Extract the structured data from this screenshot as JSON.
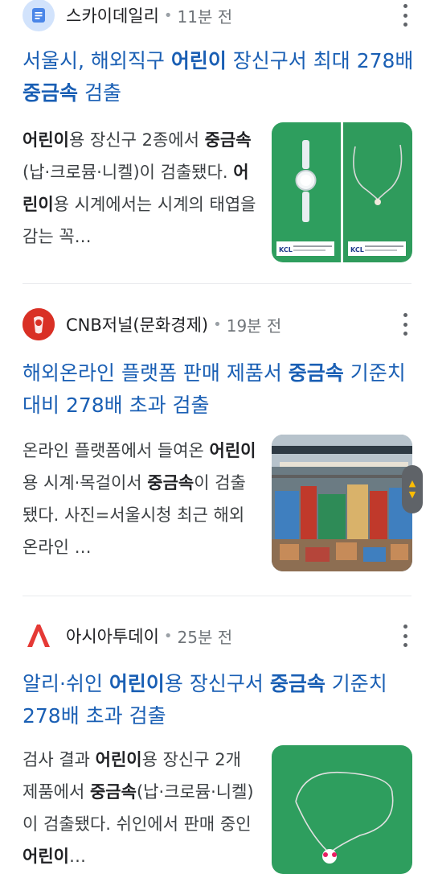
{
  "articles": [
    {
      "source": "스카이데일리",
      "time": "11분 전",
      "headline": [
        {
          "t": "서울시, 해외직구 ",
          "b": false
        },
        {
          "t": "어린이",
          "b": true
        },
        {
          "t": " 장신구서 최대 278배 ",
          "b": false
        },
        {
          "t": "중금속",
          "b": true
        },
        {
          "t": " 검출",
          "b": false
        }
      ],
      "snippet": [
        {
          "t": "어린이",
          "b": true
        },
        {
          "t": "용 장신구 2종에서 ",
          "b": false
        },
        {
          "t": "중금속",
          "b": true
        },
        {
          "t": "(납·크로뮴·니켈)이 검출됐다. ",
          "b": false
        },
        {
          "t": "어린이",
          "b": true
        },
        {
          "t": "용 시계에서는 시계의 태엽을 감는 꼭…",
          "b": false
        }
      ],
      "thumb_label": "KCL 한국건설생활환경시험연구원"
    },
    {
      "source": "CNB저널(문화경제)",
      "time": "19분 전",
      "headline": [
        {
          "t": "해외온라인 플랫폼 판매 제품서 ",
          "b": false
        },
        {
          "t": "중금속",
          "b": true
        },
        {
          "t": " 기준치 대비 278배 초과 검출",
          "b": false
        }
      ],
      "snippet": [
        {
          "t": "온라인 플랫폼에서 들여온 ",
          "b": false
        },
        {
          "t": "어린이",
          "b": true
        },
        {
          "t": "용 시계·목걸이서 ",
          "b": false
        },
        {
          "t": "중금속",
          "b": true
        },
        {
          "t": "이 검출 됐다. 사진=서울시청 최근 해외 온라인 …",
          "b": false
        }
      ]
    },
    {
      "source": "아시아투데이",
      "time": "25분 전",
      "headline": [
        {
          "t": "알리·쉬인 ",
          "b": false
        },
        {
          "t": "어린이",
          "b": true
        },
        {
          "t": "용 장신구서 ",
          "b": false
        },
        {
          "t": "중금속",
          "b": true
        },
        {
          "t": " 기준치 278배 초과 검출",
          "b": false
        }
      ],
      "snippet": [
        {
          "t": "검사 결과 ",
          "b": false
        },
        {
          "t": "어린이",
          "b": true
        },
        {
          "t": "용 장신구 2개 제품에서 ",
          "b": false
        },
        {
          "t": "중금속",
          "b": true
        },
        {
          "t": "(납·크로뮴·니켈)이 검출됐다. 쉬인에서 판매 중인 ",
          "b": false
        },
        {
          "t": "어린이",
          "b": true
        },
        {
          "t": "…",
          "b": false
        }
      ]
    }
  ],
  "icons": {
    "sky_logo": "document-icon",
    "cnb_logo": "cnb-logo-icon",
    "asia_logo": "asia-today-logo-icon",
    "more": "more-vert-icon"
  },
  "colors": {
    "headline": "#1a5fb4",
    "sky_logo_bg": "#d2e3fc",
    "cnb_logo_bg": "#d93025",
    "asia_logo": "#e53935",
    "thumb_green": "#2e9e5e"
  }
}
